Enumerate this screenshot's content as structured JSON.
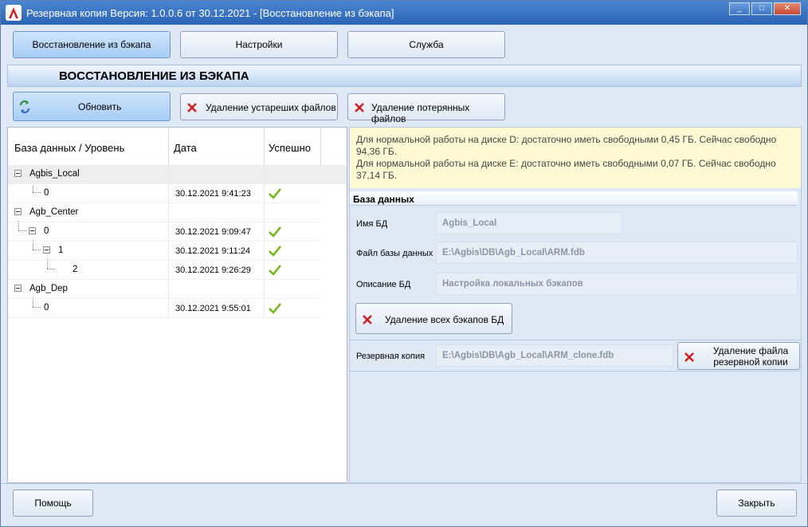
{
  "window": {
    "title": "Резервная копия   Версия: 1.0.0.6 от 30.12.2021 - [Восстановление из бэкапа]",
    "controls": [
      "_",
      "□",
      "✕"
    ]
  },
  "tabs": [
    {
      "label": "Восстановление из бэкапа",
      "active": true
    },
    {
      "label": "Настройки",
      "active": false
    },
    {
      "label": "Служба",
      "active": false
    }
  ],
  "section": {
    "title": "ВОССТАНОВЛЕНИЕ ИЗ БЭКАПА"
  },
  "toolbar": {
    "refresh": "Обновить",
    "delete_old": "Удаление устареших файлов",
    "delete_lost": "Удаление потерянных файлов"
  },
  "tree": {
    "headers": {
      "db_level": "База данных / Уровень",
      "date": "Дата",
      "success": "Успешно"
    },
    "rows": [
      {
        "label": "Agbis_Local",
        "date": "",
        "ok": false,
        "selected": true
      },
      {
        "label": "0",
        "date": "30.12.2021 9:41:23",
        "ok": true
      },
      {
        "label": "Agb_Center",
        "date": "",
        "ok": false
      },
      {
        "label": "0",
        "date": "30.12.2021 9:09:47",
        "ok": true
      },
      {
        "label": "1",
        "date": "30.12.2021 9:11:24",
        "ok": true
      },
      {
        "label": "2",
        "date": "30.12.2021 9:26:29",
        "ok": true
      },
      {
        "label": "Agb_Dep",
        "date": "",
        "ok": false
      },
      {
        "label": "0",
        "date": "30.12.2021 9:55:01",
        "ok": true
      }
    ]
  },
  "info": {
    "line1": "Для нормальной работы на диске D: достаточно иметь свободными 0,45 ГБ. Сейчас свободно 94,36 ГБ.",
    "line2": "Для нормальной работы на диске E: достаточно иметь свободными 0,07 ГБ. Сейчас свободно 37,14 ГБ."
  },
  "database": {
    "group_title": "База данных",
    "name_label": "Имя БД",
    "name_value": "Agbis_Local",
    "file_label": "Файл базы данных",
    "file_value": "E:\\Agbis\\DB\\Agb_Local\\ARM.fdb",
    "desc_label": "Описание БД",
    "desc_value": "Настройка локальных бэкапов",
    "delete_all": "Удаление всех бэкапов БД"
  },
  "backup": {
    "label": "Резервная копия",
    "value": "E:\\Agbis\\DB\\Agb_Local\\ARM_clone.fdb",
    "delete_line1": "Удаление файла",
    "delete_line2": "резервной копии"
  },
  "footer": {
    "help": "Помощь",
    "close": "Закрыть"
  },
  "colors": {
    "accent": "#2a63b4",
    "ok": "#7ab51d",
    "delete": "#d11a1a",
    "info_bg": "#fff9d4"
  }
}
